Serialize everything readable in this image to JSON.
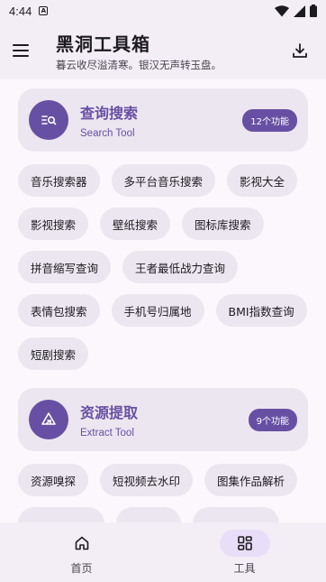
{
  "status": {
    "time": "4:44"
  },
  "header": {
    "title": "黑洞工具箱",
    "subtitle": "暮云收尽溢清寒。银汉无声转玉盘。"
  },
  "sections": [
    {
      "title": "查询搜索",
      "subtitle": "Search Tool",
      "badge": "12个功能",
      "icon": "search-list-icon",
      "items": [
        "音乐搜索器",
        "多平台音乐搜索",
        "影视大全",
        "影视搜索",
        "壁纸搜索",
        "图标库搜索",
        "拼音缩写查询",
        "王者最低战力查询",
        "表情包搜索",
        "手机号归属地",
        "BMI指数查询",
        "短剧搜索"
      ]
    },
    {
      "title": "资源提取",
      "subtitle": "Extract Tool",
      "badge": "9个功能",
      "icon": "extract-icon",
      "items": [
        "资源嗅探",
        "短视频去水印",
        "图集作品解析"
      ]
    }
  ],
  "bottom_nav": [
    {
      "label": "首页",
      "icon": "home-icon",
      "active": false
    },
    {
      "label": "工具",
      "icon": "grid-icon",
      "active": true
    }
  ],
  "colors": {
    "primary": "#6750a4",
    "card": "#ece6f0",
    "background": "#fcf7fc"
  }
}
